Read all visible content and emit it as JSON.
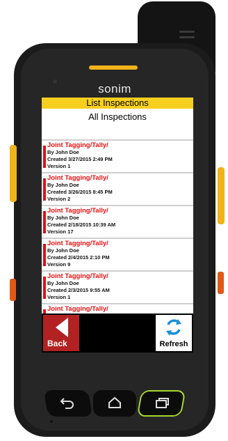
{
  "device": {
    "brand": "sonim"
  },
  "header": {
    "title": "List Inspections",
    "subtitle": "All Inspections"
  },
  "inspections": [
    {
      "title": "Joint Tagging/Tally/",
      "by": "By John Doe",
      "created": "Created 3/27/2015 2:49 PM",
      "version": "Version 1"
    },
    {
      "title": "Joint Tagging/Tally/",
      "by": "By John Doe",
      "created": "Created 3/26/2015 8:45 PM",
      "version": "Version 2"
    },
    {
      "title": "Joint Tagging/Tally/",
      "by": "By John Doe",
      "created": "Created 2/18/2015 10:39 AM",
      "version": "Version 17"
    },
    {
      "title": "Joint Tagging/Tally/",
      "by": "By John Doe",
      "created": "Created 2/4/2015 2:10 PM",
      "version": "Version 9"
    },
    {
      "title": "Joint Tagging/Tally/",
      "by": "By John Doe",
      "created": "Created 2/3/2015 9:55 AM",
      "version": "Version 1"
    },
    {
      "title": "Joint Tagging/Tally/",
      "by": "",
      "created": "",
      "version": ""
    }
  ],
  "buttons": {
    "back_label": "Back",
    "refresh_label": "Refresh"
  },
  "nav": {
    "back_icon": "back-arrow-icon",
    "home_icon": "home-icon",
    "recent_icon": "recent-apps-icon"
  },
  "colors": {
    "accent": "#f7cf1e",
    "item_title": "#e01010",
    "back_button": "#b32222",
    "refresh_icon": "#1e8fd6",
    "recent_outline": "#a7d630"
  }
}
